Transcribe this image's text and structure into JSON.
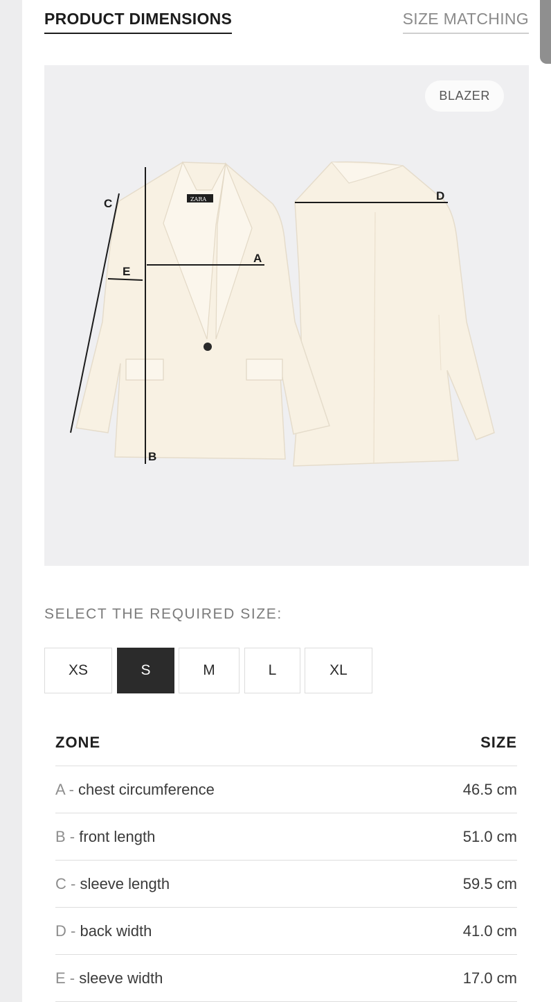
{
  "tabs": {
    "dimensions": "PRODUCT DIMENSIONS",
    "matching": "SIZE MATCHING"
  },
  "image": {
    "badge": "BLAZER",
    "logo": "ZARA",
    "markers": {
      "a": "A",
      "b": "B",
      "c": "C",
      "d": "D",
      "e": "E"
    }
  },
  "size_select": {
    "label": "SELECT THE REQUIRED SIZE:",
    "options": [
      "XS",
      "S",
      "M",
      "L",
      "XL"
    ],
    "selected": "S"
  },
  "table": {
    "header_zone": "ZONE",
    "header_size": "SIZE",
    "rows": [
      {
        "letter": "A",
        "sep": " - ",
        "zone": "chest circumference",
        "size": "46.5 cm"
      },
      {
        "letter": "B",
        "sep": " - ",
        "zone": "front length",
        "size": "51.0 cm"
      },
      {
        "letter": "C",
        "sep": " - ",
        "zone": "sleeve length",
        "size": "59.5 cm"
      },
      {
        "letter": "D",
        "sep": " - ",
        "zone": "back width",
        "size": "41.0 cm"
      },
      {
        "letter": "E",
        "sep": " - ",
        "zone": "sleeve width",
        "size": "17.0 cm"
      }
    ]
  },
  "colors": {
    "selected_bg": "#2b2b2b",
    "blazer_fill": "#f8f1e3",
    "panel_bg": "#efeff1"
  }
}
